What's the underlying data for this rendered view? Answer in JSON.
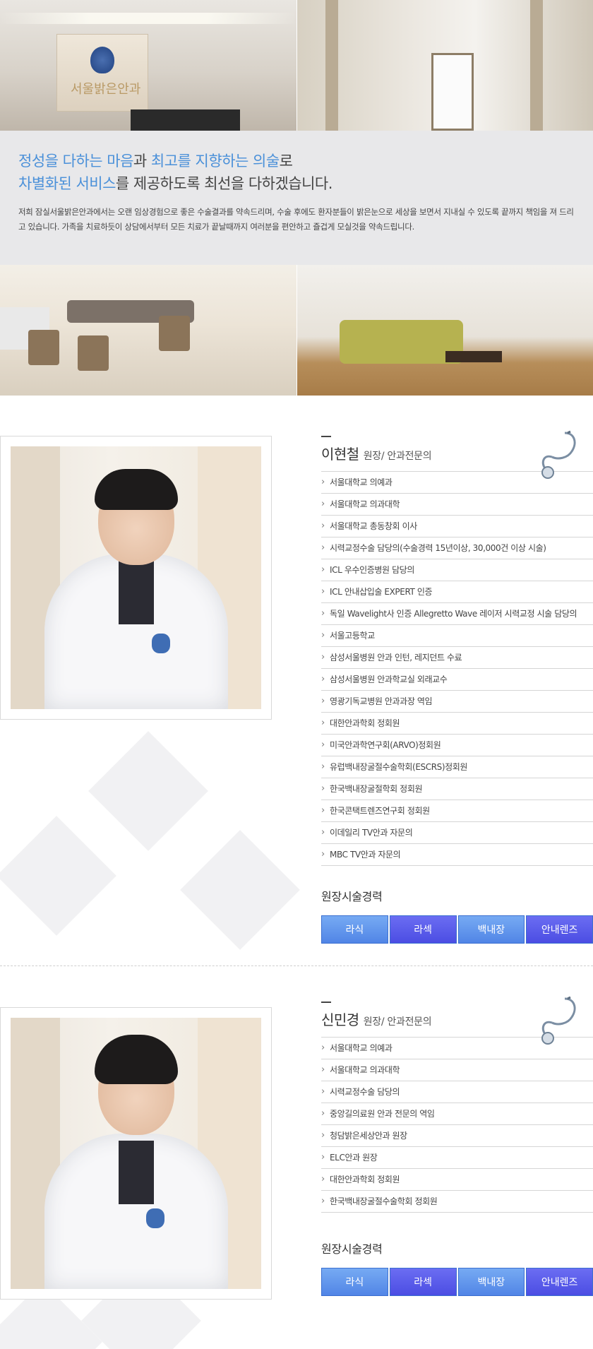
{
  "hero": {
    "headline_line1_hl1": "정성을 다하는 마음",
    "headline_line1_mid": "과 ",
    "headline_line1_hl2": "최고를 지향하는 의술",
    "headline_line1_end": "로",
    "headline_line2_hl": "차별화된 서비스",
    "headline_line2_end": "를 제공하도록 최선을 다하겠습니다.",
    "intro": "저희 잠실서울밝은안과에서는 오랜 임상경험으로 좋은 수술결과를 약속드리며, 수술 후에도 환자분들이 밝은눈으로 세상을 보면서 지내실 수 있도록 끝까지 책임을 져 드리고 있습니다. 가족을 치료하듯이 상담에서부터 모든 치료가 끝날때까지 여러분을 편안하고 즐겁게 모실것을 약속드립니다.",
    "brand_sign": "서울밝은안과"
  },
  "doctors": [
    {
      "name": "이현철",
      "title": "원장/ 안과전문의",
      "career": [
        "서울대학교 의예과",
        "서울대학교 의과대학",
        "서울대학교 총동창회 이사",
        "시력교정수술 담당의(수술경력 15년이상, 30,000건 이상 시술)",
        "ICL 우수인증병원 담당의",
        "ICL 안내삽입술 EXPERT 인증",
        "독일 Wavelight사 인증 Allegretto Wave 레이저 시력교정 시술 담당의",
        "서울고등학교",
        "삼성서울병원 안과 인턴, 레지던트 수료",
        "삼성서울병원 안과학교실 외래교수",
        "영광기독교병원 안과과장 역임",
        "대한안과학회 정회원",
        "미국안과학연구회(ARVO)정회원",
        "유럽백내장굴절수술학회(ESCRS)정회원",
        "한국백내장굴절학회 정회원",
        "한국콘택트렌즈연구회 정회원",
        "이데일리 TV안과 자문의",
        "MBC TV안과 자문의"
      ],
      "surgery_label": "원장시술경력",
      "buttons": [
        "라식",
        "라섹",
        "백내장",
        "안내렌즈"
      ]
    },
    {
      "name": "신민경",
      "title": "원장/ 안과전문의",
      "career": [
        "서울대학교 의예과",
        "서울대학교 의과대학",
        "시력교정수술 담당의",
        "중앙길의료원 안과 전문의 역임",
        "청담밝은세상안과 원장",
        "ELC안과 원장",
        "대한안과학회 정회원",
        "한국백내장굴절수술학회 정회원"
      ],
      "surgery_label": "원장시술경력",
      "buttons": [
        "라식",
        "라섹",
        "백내장",
        "안내렌즈"
      ]
    }
  ]
}
